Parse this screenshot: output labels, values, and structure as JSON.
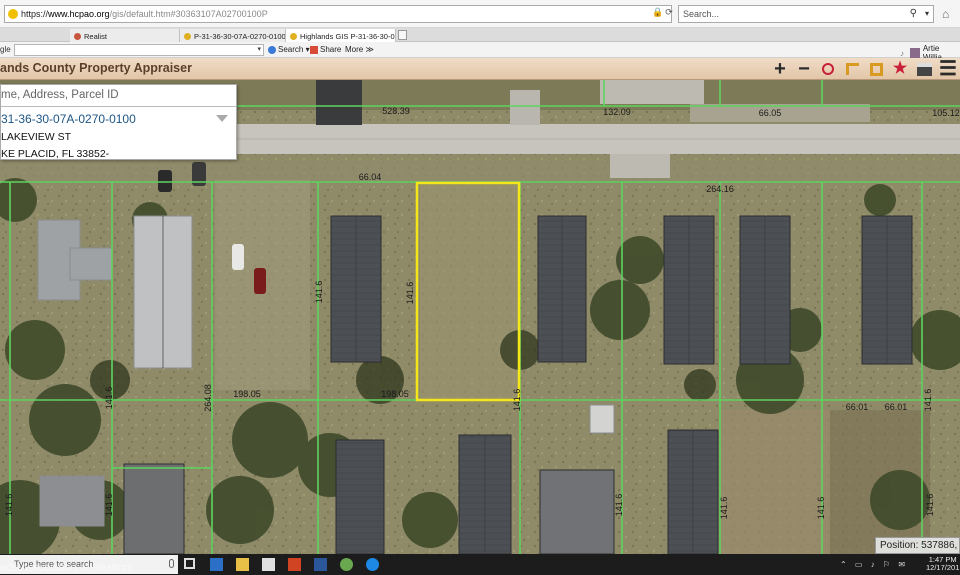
{
  "browser": {
    "url_scheme": "https://",
    "url_host": "www.hcpao.org",
    "url_path": "/gis/default.htm#30363107A02700100P",
    "search_placeholder": "Search...",
    "tabs": [
      {
        "label": "Realist",
        "color": "#c8553d"
      },
      {
        "label": "P-31-36-30-07A-0270-0100 - H...",
        "color": "#e0b020"
      },
      {
        "label": "Highlands GIS P-31-36-30-0...",
        "color": "#e0b020"
      }
    ]
  },
  "toolbar": {
    "google_label": "gle",
    "search_label": "Search",
    "share_label": "Share",
    "more_label": "More ≫",
    "user_name": "Artie Willia"
  },
  "app": {
    "title": "ands County Property Appraiser",
    "tools": [
      {
        "icon": "zoom-in-icon",
        "glyph": "+",
        "color": "#2a2a2a"
      },
      {
        "icon": "zoom-out-icon",
        "glyph": "−",
        "color": "#2a2a2a"
      },
      {
        "icon": "zoom-box-icon",
        "glyph": "",
        "color": "#c8203a"
      },
      {
        "icon": "measure-line-icon",
        "glyph": "",
        "color": "#d89a20"
      },
      {
        "icon": "measure-area-icon",
        "glyph": "",
        "color": "#d89a20"
      },
      {
        "icon": "star-icon",
        "glyph": "★",
        "color": "#c8203a"
      },
      {
        "icon": "print-icon",
        "glyph": "",
        "color": "#444444"
      },
      {
        "icon": "menu-icon",
        "glyph": "☰",
        "color": "#2a2a2a"
      }
    ]
  },
  "search_panel": {
    "placeholder": "me, Address, Parcel ID",
    "parcel_id": "31-36-30-07A-0270-0100",
    "address_line1": "LAKEVIEW ST",
    "address_line2": "KE PLACID, FL 33852-"
  },
  "map": {
    "parcel_colors": {
      "lines": "#5fd35f",
      "selected": "#f5e61a"
    },
    "dimension_labels": [
      {
        "text": "528.39"
      },
      {
        "text": "132.09"
      },
      {
        "text": "66.05"
      },
      {
        "text": "105.12"
      },
      {
        "text": "66.04"
      },
      {
        "text": "264.16"
      },
      {
        "text": "141.6"
      },
      {
        "text": "141.6"
      },
      {
        "text": "198.05"
      },
      {
        "text": "198.05"
      },
      {
        "text": "66.01"
      },
      {
        "text": "66.01"
      },
      {
        "text": "264.08"
      },
      {
        "text": "141.6"
      },
      {
        "text": "141.6"
      },
      {
        "text": "141.6"
      },
      {
        "text": "141.6"
      },
      {
        "text": "141.6"
      },
      {
        "text": "141.6"
      },
      {
        "text": "141.6"
      },
      {
        "text": "141.6"
      },
      {
        "text": "141.6"
      }
    ]
  },
  "position_readout": "Position: 537886, 10",
  "taskbar": {
    "search_placeholder": "Type here to search",
    "time": "1:47 PM",
    "date": "12/17/201"
  },
  "watermark": "nds Association of Realtors"
}
